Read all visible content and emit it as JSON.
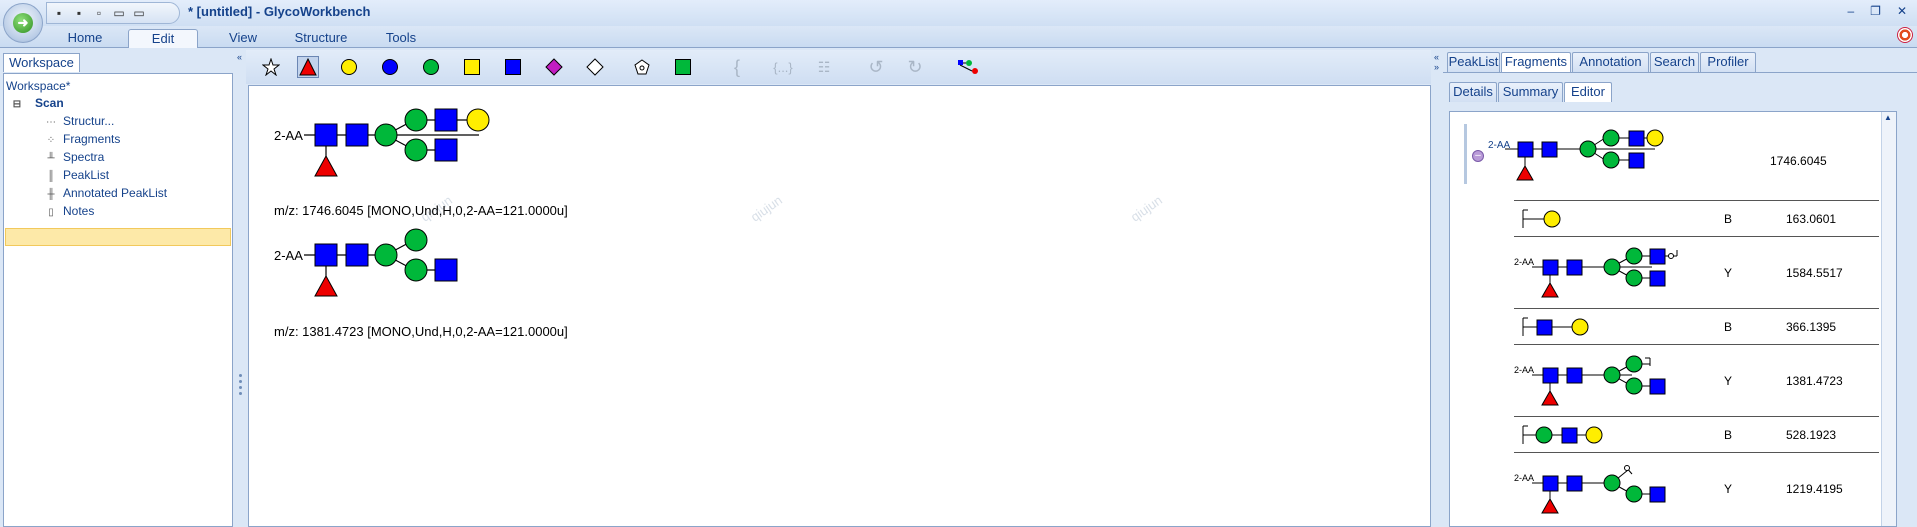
{
  "window": {
    "title": "* [untitled] - GlycoWorkbench",
    "controls": [
      "–",
      "❐",
      "✕"
    ]
  },
  "ribbon": {
    "tabs": [
      "Home",
      "Edit",
      "View",
      "Structure",
      "Tools"
    ],
    "active_tab": "Edit"
  },
  "workspace": {
    "tab_label": "Workspace",
    "tree": {
      "root": "Workspace*",
      "scan": "Scan",
      "items": [
        "Structur...",
        "Fragments",
        "Spectra",
        "PeakList",
        "Annotated PeakList",
        "Notes"
      ],
      "selected": "Notes"
    }
  },
  "editor": {
    "toolbar_icons": [
      "star-icon",
      "triangle-icon",
      "yellow-circle-icon",
      "blue-circle-icon",
      "green-circle-icon",
      "yellow-square-icon",
      "blue-square-icon",
      "magenta-diamond-icon",
      "white-diamond-icon",
      "pentagon-icon",
      "green-square-icon",
      "bracket-icon",
      "repeat-bracket-icon",
      "properties-icon",
      "undo-icon",
      "redo-icon",
      "orientation-icon"
    ],
    "structures": [
      {
        "reducing_end": "2-AA",
        "mz_label": "m/z: 1746.6045 [MONO,Und,H,0,2-AA=121.0000u]"
      },
      {
        "reducing_end": "2-AA",
        "mz_label": "m/z: 1381.4723 [MONO,Und,H,0,2-AA=121.0000u]"
      }
    ],
    "watermark": "qiujun"
  },
  "right_panel": {
    "tabs": [
      "PeakList",
      "Fragments",
      "Annotation",
      "Search",
      "Profiler"
    ],
    "active_tab": "Fragments",
    "subtabs": [
      "Details",
      "Summary",
      "Editor"
    ],
    "active_subtab": "Editor",
    "parent": {
      "reducing_end": "2-AA",
      "mass": "1746.6045"
    },
    "fragments": [
      {
        "type": "B",
        "mass": "163.0601"
      },
      {
        "type": "Y",
        "mass": "1584.5517",
        "reducing_end": "2-AA"
      },
      {
        "type": "B",
        "mass": "366.1395"
      },
      {
        "type": "Y",
        "mass": "1381.4723",
        "reducing_end": "2-AA"
      },
      {
        "type": "B",
        "mass": "528.1923"
      },
      {
        "type": "Y",
        "mass": "1219.4195",
        "reducing_end": "2-AA"
      }
    ]
  },
  "colors": {
    "glcnac": "#0000ff",
    "man": "#00b83a",
    "gal": "#ffee00",
    "fuc": "#ee0000",
    "ribbon_bg": "#dbe7f6"
  }
}
